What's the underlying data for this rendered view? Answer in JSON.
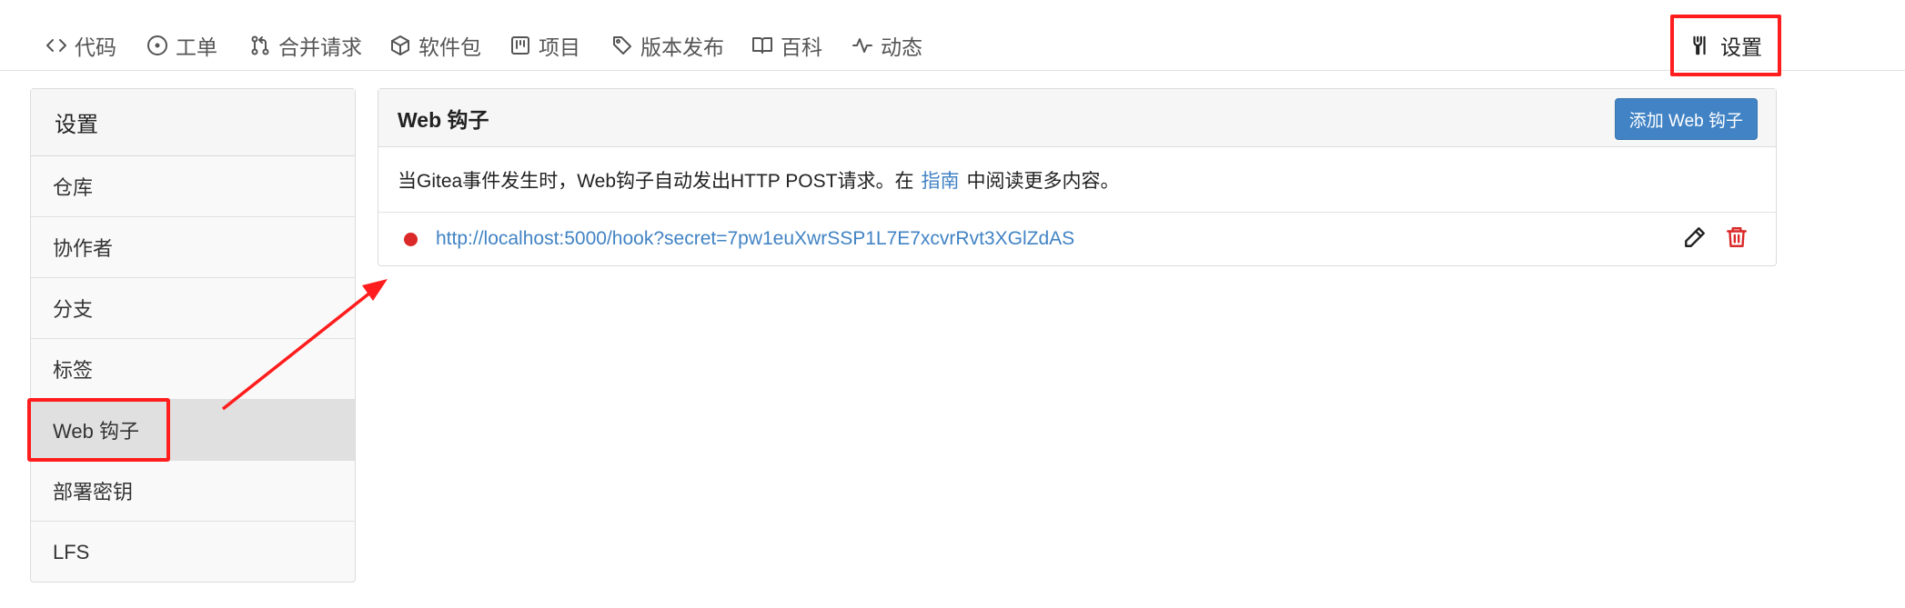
{
  "nav": {
    "items": [
      {
        "label": "代码",
        "icon": "code-icon"
      },
      {
        "label": "工单",
        "icon": "issue-opened-icon"
      },
      {
        "label": "合并请求",
        "icon": "git-pull-request-icon"
      },
      {
        "label": "软件包",
        "icon": "package-icon"
      },
      {
        "label": "项目",
        "icon": "project-icon"
      },
      {
        "label": "版本发布",
        "icon": "tag-icon"
      },
      {
        "label": "百科",
        "icon": "book-icon"
      },
      {
        "label": "动态",
        "icon": "pulse-icon"
      }
    ],
    "settings_label": "设置"
  },
  "sidebar": {
    "header": "设置",
    "items": [
      {
        "label": "仓库"
      },
      {
        "label": "协作者"
      },
      {
        "label": "分支"
      },
      {
        "label": "标签"
      },
      {
        "label": "Web 钩子",
        "active": true
      },
      {
        "label": "部署密钥"
      },
      {
        "label": "LFS"
      }
    ]
  },
  "panel": {
    "title": "Web 钩子",
    "add_button": "添加 Web 钩子",
    "desc_before": "当Gitea事件发生时，Web钩子自动发出HTTP POST请求。在",
    "desc_link": "指南",
    "desc_after": "中阅读更多内容。",
    "hooks": [
      {
        "url": "http://localhost:5000/hook?secret=7pw1euXwrSSP1L7E7xcvrRvt3XGlZdAS",
        "status": "failed"
      }
    ]
  },
  "colors": {
    "accent": "#4183c4",
    "highlight": "#ff1d1d",
    "status_failed": "#db2828"
  }
}
